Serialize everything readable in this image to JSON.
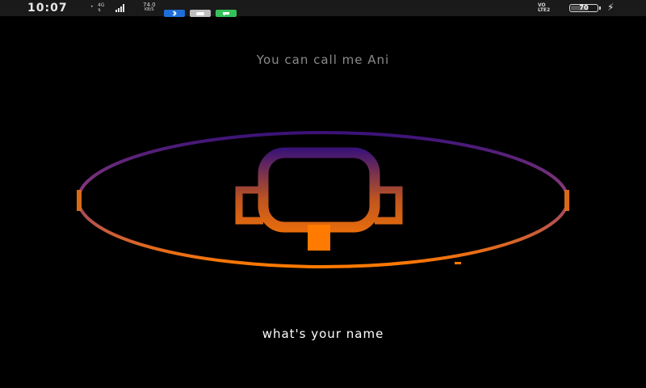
{
  "status_bar": {
    "time": "10:07",
    "network_type": "4G",
    "data_rate_value": "74.0",
    "data_rate_unit": "KB/S",
    "volte_top": "VO",
    "volte_bottom": "LTE2",
    "battery_level": "70",
    "battery_fraction": 0.7,
    "charging": true,
    "notification_icons": [
      "bluetooth-icon",
      "gamepad-icon",
      "chat-icon"
    ],
    "notification_colors": [
      "#1e6fd9",
      "#bfbfbf",
      "#35c25a"
    ]
  },
  "assistant": {
    "intro_text": "You can call me Ani",
    "query_text": "what's your name"
  },
  "colors": {
    "gradient_top": "#3a1278",
    "gradient_bottom": "#ff7a00",
    "background": "#000000"
  }
}
